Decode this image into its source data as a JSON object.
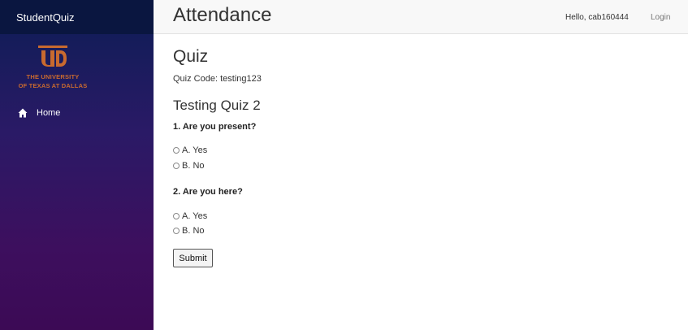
{
  "sidebar": {
    "brand": "StudentQuiz",
    "logo": {
      "line1": "THE UNIVERSITY",
      "line2": "OF TEXAS AT DALLAS"
    },
    "nav": [
      {
        "label": "Home",
        "icon": "home-icon"
      }
    ]
  },
  "header": {
    "title": "Attendance",
    "greeting": "Hello, cab160444",
    "login_label": "Login"
  },
  "quiz": {
    "heading": "Quiz",
    "code_text": "Quiz Code: testing123",
    "name": "Testing Quiz 2",
    "questions": [
      {
        "text": "1. Are you present?",
        "options": [
          "A. Yes",
          "B. No"
        ]
      },
      {
        "text": "2. Are you here?",
        "options": [
          "A. Yes",
          "B. No"
        ]
      }
    ],
    "submit_label": "Submit"
  },
  "colors": {
    "sidebar_top": "#0a1640",
    "sidebar_gradient_start": "#0c1d55",
    "sidebar_gradient_end": "#3c0a55",
    "logo_orange": "#c86a2f"
  }
}
